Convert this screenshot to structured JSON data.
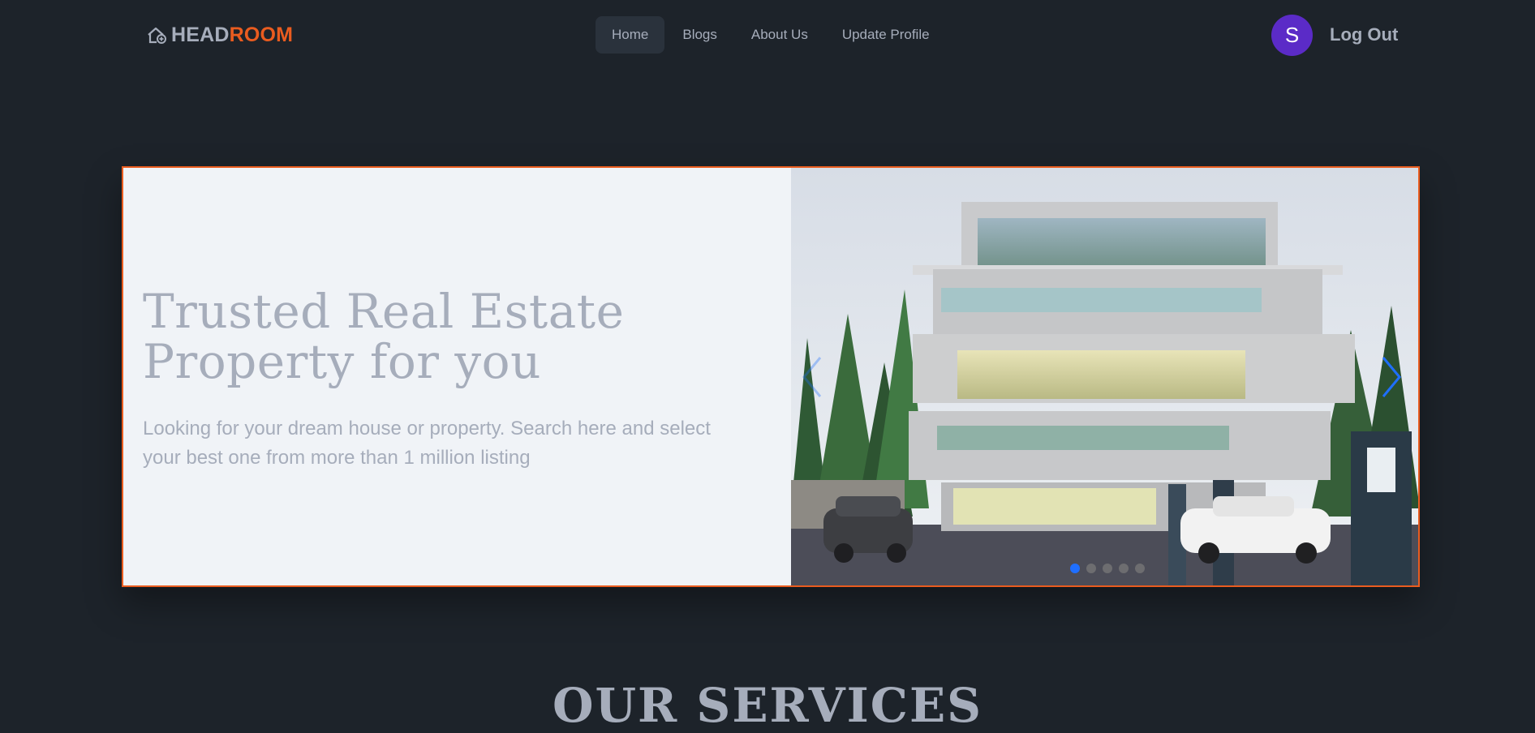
{
  "brand": {
    "part1": "HEAD",
    "part2": "ROOM",
    "icon": "house-icon",
    "color_part1": "#a6adbb",
    "color_part2": "#ea5c1f"
  },
  "nav": {
    "items": [
      {
        "label": "Home",
        "active": true
      },
      {
        "label": "Blogs",
        "active": false
      },
      {
        "label": "About Us",
        "active": false
      },
      {
        "label": "Update Profile",
        "active": false
      }
    ]
  },
  "user": {
    "avatar_initial": "S",
    "avatar_color": "#5b2bc7",
    "logout_label": "Log Out"
  },
  "hero": {
    "title_line1": "Trusted Real Estate",
    "title_line2": "Property for you",
    "subtitle": "Looking for your dream house or property. Search here and select your best one from more than 1 million listing",
    "border_color": "#ea5c1f",
    "carousel": {
      "slide_count": 5,
      "active_slide": 1,
      "prev_icon": "chevron-left-icon",
      "next_icon": "chevron-right-icon",
      "accent": "#1f6fff"
    }
  },
  "services": {
    "heading": "OUR SERVICES"
  },
  "colors": {
    "background": "#1d232a",
    "nav_active_bg": "#2a323c",
    "text_muted": "#a6adbb"
  }
}
